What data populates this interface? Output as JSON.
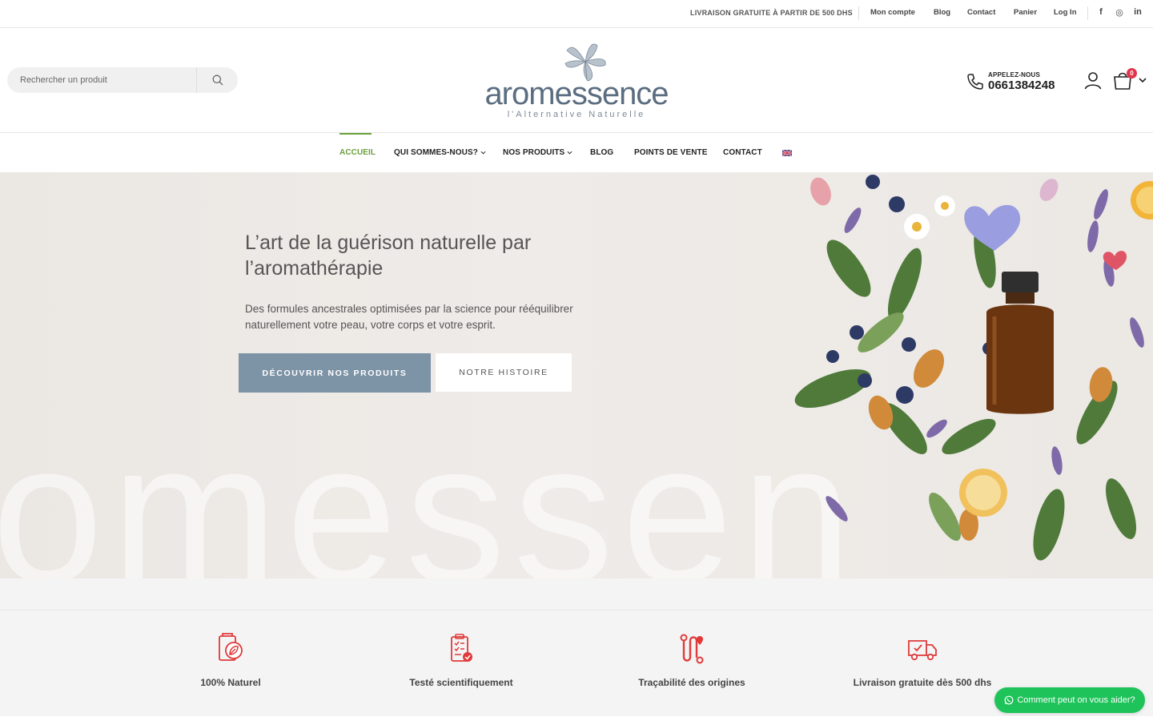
{
  "topbar": {
    "notice": "LIVRAISON GRATUITE À PARTIR DE 500 DHS",
    "links": [
      "Mon compte",
      "Blog",
      "Contact",
      "Panier",
      "Log In"
    ],
    "social": [
      "f",
      "◎",
      "in"
    ]
  },
  "header": {
    "search_placeholder": "Rechercher un produit",
    "logo_text": "aromessence",
    "logo_tagline": "l'Alternative Naturelle",
    "phone_label": "APPELEZ-NOUS",
    "phone_number": "0661384248",
    "cart_count": "0"
  },
  "nav": {
    "items": [
      "ACCUEIL",
      "QUI SOMMES-NOUS?",
      "NOS PRODUITS",
      "BLOG",
      "POINTS DE VENTE",
      "CONTACT"
    ],
    "active": "ACCUEIL"
  },
  "hero": {
    "title": "L’art de la guérison naturelle par l’aromathérapie",
    "subtitle": "Des formules ancestrales optimisées par la science pour rééquilibrer naturellement votre peau, votre corps et votre esprit.",
    "primary_button": "DÉCOUVRIR NOS PRODUITS",
    "secondary_button": "NOTRE HISTOIRE",
    "background_word": "omessen"
  },
  "features": [
    {
      "label": "100% Naturel",
      "icon": "natural-leaf-icon"
    },
    {
      "label": "Testé scientifiquement",
      "icon": "clipboard-check-icon"
    },
    {
      "label": "Traçabilité des origines",
      "icon": "route-icon"
    },
    {
      "label": "Livraison gratuite dès 500 dhs",
      "icon": "delivery-truck-icon"
    }
  ],
  "whatsapp": {
    "label": "Comment peut on vous aider?"
  },
  "colors": {
    "accent_green": "#6aa03b",
    "primary_button": "#7d93a6",
    "icon_red": "#e03a3a",
    "whatsapp": "#1ec35a"
  }
}
